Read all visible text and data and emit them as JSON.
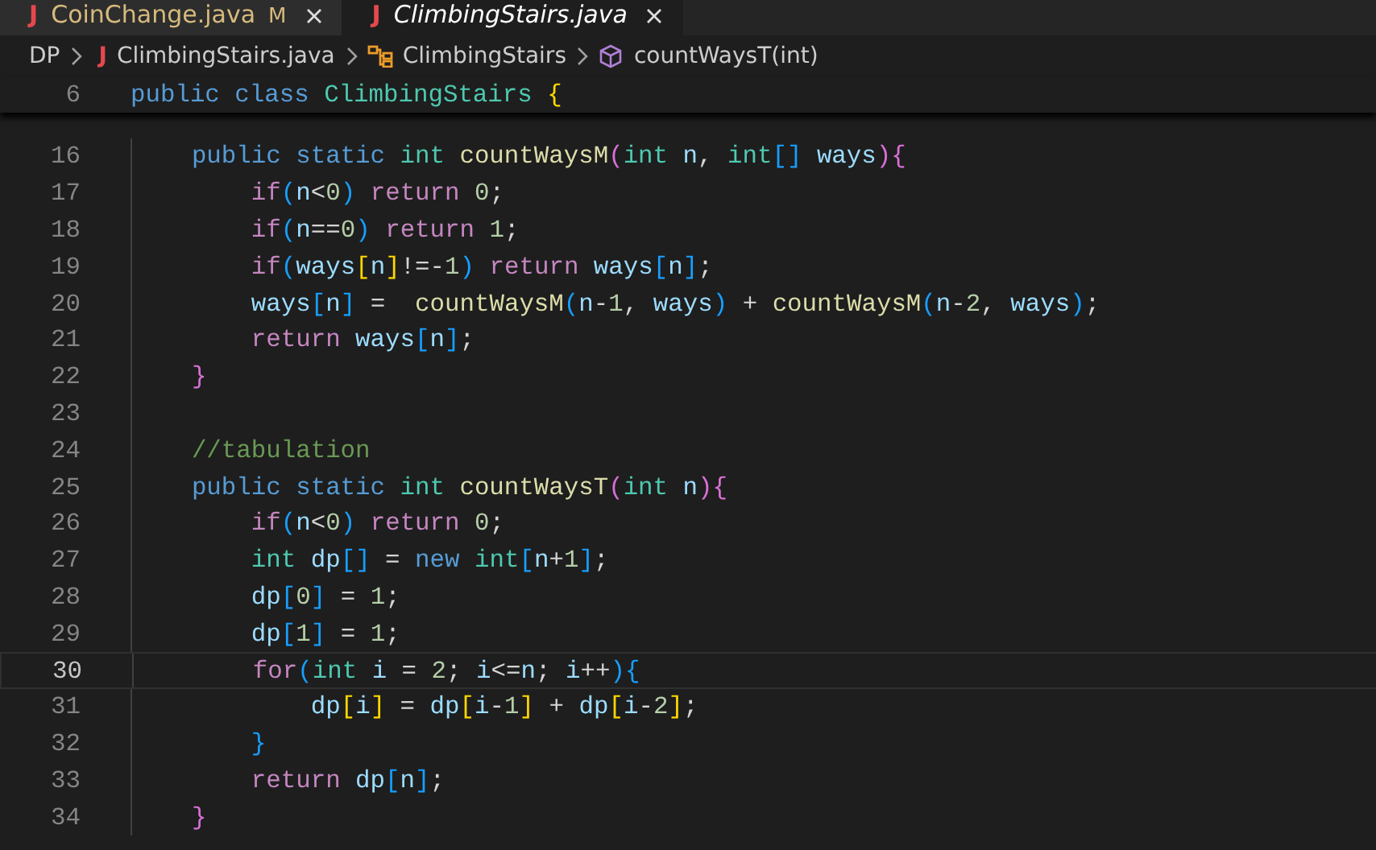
{
  "tabs": [
    {
      "icon": "J",
      "label": "CoinChange.java",
      "badge": "M",
      "selected": false
    },
    {
      "icon": "J",
      "label": "ClimbingStairs.java",
      "selected": true
    }
  ],
  "breadcrumb": [
    {
      "kind": "folder",
      "text": "DP"
    },
    {
      "kind": "file",
      "icon": "J",
      "text": "ClimbingStairs.java"
    },
    {
      "kind": "class",
      "text": "ClimbingStairs"
    },
    {
      "kind": "method",
      "text": "countWaysT(int)"
    }
  ],
  "sticky_line": {
    "number": "6",
    "tokens": [
      {
        "kind": "kw",
        "text": "public class "
      },
      {
        "kind": "type",
        "text": "ClimbingStairs "
      },
      {
        "kind": "br1",
        "text": "{"
      }
    ]
  },
  "lines": [
    {
      "number": "16",
      "current": false,
      "tokens": [
        {
          "kind": "kw",
          "text": "    public static "
        },
        {
          "kind": "type",
          "text": "int "
        },
        {
          "kind": "fn",
          "text": "countWaysM"
        },
        {
          "kind": "br2",
          "text": "("
        },
        {
          "kind": "type",
          "text": "int "
        },
        {
          "kind": "var",
          "text": "n"
        },
        {
          "kind": "op",
          "text": ", "
        },
        {
          "kind": "type",
          "text": "int"
        },
        {
          "kind": "br3",
          "text": "[] "
        },
        {
          "kind": "var",
          "text": "ways"
        },
        {
          "kind": "br2",
          "text": "){"
        }
      ]
    },
    {
      "number": "17",
      "current": false,
      "tokens": [
        {
          "kind": "ctl",
          "text": "        if"
        },
        {
          "kind": "br3",
          "text": "("
        },
        {
          "kind": "var",
          "text": "n"
        },
        {
          "kind": "op",
          "text": "<"
        },
        {
          "kind": "num",
          "text": "0"
        },
        {
          "kind": "br3",
          "text": ") "
        },
        {
          "kind": "ctl",
          "text": "return "
        },
        {
          "kind": "num",
          "text": "0"
        },
        {
          "kind": "op",
          "text": ";"
        }
      ]
    },
    {
      "number": "18",
      "current": false,
      "tokens": [
        {
          "kind": "ctl",
          "text": "        if"
        },
        {
          "kind": "br3",
          "text": "("
        },
        {
          "kind": "var",
          "text": "n"
        },
        {
          "kind": "op",
          "text": "=="
        },
        {
          "kind": "num",
          "text": "0"
        },
        {
          "kind": "br3",
          "text": ") "
        },
        {
          "kind": "ctl",
          "text": "return "
        },
        {
          "kind": "num",
          "text": "1"
        },
        {
          "kind": "op",
          "text": ";"
        }
      ]
    },
    {
      "number": "19",
      "current": false,
      "tokens": [
        {
          "kind": "ctl",
          "text": "        if"
        },
        {
          "kind": "br3",
          "text": "("
        },
        {
          "kind": "var",
          "text": "ways"
        },
        {
          "kind": "br1",
          "text": "["
        },
        {
          "kind": "var",
          "text": "n"
        },
        {
          "kind": "br1",
          "text": "]"
        },
        {
          "kind": "op",
          "text": "!=-"
        },
        {
          "kind": "num",
          "text": "1"
        },
        {
          "kind": "br3",
          "text": ") "
        },
        {
          "kind": "ctl",
          "text": "return "
        },
        {
          "kind": "var",
          "text": "ways"
        },
        {
          "kind": "br3",
          "text": "["
        },
        {
          "kind": "var",
          "text": "n"
        },
        {
          "kind": "br3",
          "text": "]"
        },
        {
          "kind": "op",
          "text": ";"
        }
      ]
    },
    {
      "number": "20",
      "current": false,
      "tokens": [
        {
          "kind": "var",
          "text": "        ways"
        },
        {
          "kind": "br3",
          "text": "["
        },
        {
          "kind": "var",
          "text": "n"
        },
        {
          "kind": "br3",
          "text": "]"
        },
        {
          "kind": "op",
          "text": " =  "
        },
        {
          "kind": "fn",
          "text": "countWaysM"
        },
        {
          "kind": "br3",
          "text": "("
        },
        {
          "kind": "var",
          "text": "n"
        },
        {
          "kind": "op",
          "text": "-"
        },
        {
          "kind": "num",
          "text": "1"
        },
        {
          "kind": "op",
          "text": ", "
        },
        {
          "kind": "var",
          "text": "ways"
        },
        {
          "kind": "br3",
          "text": ")"
        },
        {
          "kind": "op",
          "text": " + "
        },
        {
          "kind": "fn",
          "text": "countWaysM"
        },
        {
          "kind": "br3",
          "text": "("
        },
        {
          "kind": "var",
          "text": "n"
        },
        {
          "kind": "op",
          "text": "-"
        },
        {
          "kind": "num",
          "text": "2"
        },
        {
          "kind": "op",
          "text": ", "
        },
        {
          "kind": "var",
          "text": "ways"
        },
        {
          "kind": "br3",
          "text": ")"
        },
        {
          "kind": "op",
          "text": ";"
        }
      ]
    },
    {
      "number": "21",
      "current": false,
      "tokens": [
        {
          "kind": "ctl",
          "text": "        return "
        },
        {
          "kind": "var",
          "text": "ways"
        },
        {
          "kind": "br3",
          "text": "["
        },
        {
          "kind": "var",
          "text": "n"
        },
        {
          "kind": "br3",
          "text": "]"
        },
        {
          "kind": "op",
          "text": ";"
        }
      ]
    },
    {
      "number": "22",
      "current": false,
      "tokens": [
        {
          "kind": "br2",
          "text": "    }"
        }
      ]
    },
    {
      "number": "23",
      "current": false
    },
    {
      "number": "24",
      "current": false,
      "tokens": [
        {
          "kind": "cmt",
          "text": "    //tabulation"
        }
      ]
    },
    {
      "number": "25",
      "current": false,
      "tokens": [
        {
          "kind": "kw",
          "text": "    public static "
        },
        {
          "kind": "type",
          "text": "int "
        },
        {
          "kind": "fn",
          "text": "countWaysT"
        },
        {
          "kind": "br2",
          "text": "("
        },
        {
          "kind": "type",
          "text": "int "
        },
        {
          "kind": "var",
          "text": "n"
        },
        {
          "kind": "br2",
          "text": "){"
        }
      ]
    },
    {
      "number": "26",
      "current": false,
      "tokens": [
        {
          "kind": "ctl",
          "text": "        if"
        },
        {
          "kind": "br3",
          "text": "("
        },
        {
          "kind": "var",
          "text": "n"
        },
        {
          "kind": "op",
          "text": "<"
        },
        {
          "kind": "num",
          "text": "0"
        },
        {
          "kind": "br3",
          "text": ") "
        },
        {
          "kind": "ctl",
          "text": "return "
        },
        {
          "kind": "num",
          "text": "0"
        },
        {
          "kind": "op",
          "text": ";"
        }
      ]
    },
    {
      "number": "27",
      "current": false,
      "tokens": [
        {
          "kind": "type",
          "text": "        int "
        },
        {
          "kind": "var",
          "text": "dp"
        },
        {
          "kind": "br3",
          "text": "[]"
        },
        {
          "kind": "op",
          "text": " = "
        },
        {
          "kind": "kw",
          "text": "new "
        },
        {
          "kind": "type",
          "text": "int"
        },
        {
          "kind": "br3",
          "text": "["
        },
        {
          "kind": "var",
          "text": "n"
        },
        {
          "kind": "op",
          "text": "+"
        },
        {
          "kind": "num",
          "text": "1"
        },
        {
          "kind": "br3",
          "text": "]"
        },
        {
          "kind": "op",
          "text": ";"
        }
      ]
    },
    {
      "number": "28",
      "current": false,
      "tokens": [
        {
          "kind": "var",
          "text": "        dp"
        },
        {
          "kind": "br3",
          "text": "["
        },
        {
          "kind": "num",
          "text": "0"
        },
        {
          "kind": "br3",
          "text": "]"
        },
        {
          "kind": "op",
          "text": " = "
        },
        {
          "kind": "num",
          "text": "1"
        },
        {
          "kind": "op",
          "text": ";"
        }
      ]
    },
    {
      "number": "29",
      "current": false,
      "tokens": [
        {
          "kind": "var",
          "text": "        dp"
        },
        {
          "kind": "br3",
          "text": "["
        },
        {
          "kind": "num",
          "text": "1"
        },
        {
          "kind": "br3",
          "text": "]"
        },
        {
          "kind": "op",
          "text": " = "
        },
        {
          "kind": "num",
          "text": "1"
        },
        {
          "kind": "op",
          "text": ";"
        }
      ]
    },
    {
      "number": "30",
      "current": true,
      "tokens": [
        {
          "kind": "ctl",
          "text": "        for"
        },
        {
          "kind": "br3",
          "text": "("
        },
        {
          "kind": "type",
          "text": "int "
        },
        {
          "kind": "var",
          "text": "i"
        },
        {
          "kind": "op",
          "text": " = "
        },
        {
          "kind": "num",
          "text": "2"
        },
        {
          "kind": "op",
          "text": "; "
        },
        {
          "kind": "var",
          "text": "i"
        },
        {
          "kind": "op",
          "text": "<="
        },
        {
          "kind": "var",
          "text": "n"
        },
        {
          "kind": "op",
          "text": "; "
        },
        {
          "kind": "var",
          "text": "i"
        },
        {
          "kind": "op",
          "text": "++"
        },
        {
          "kind": "br3",
          "text": "){"
        }
      ]
    },
    {
      "number": "31",
      "current": false,
      "tokens": [
        {
          "kind": "var",
          "text": "            dp"
        },
        {
          "kind": "br1",
          "text": "["
        },
        {
          "kind": "var",
          "text": "i"
        },
        {
          "kind": "br1",
          "text": "]"
        },
        {
          "kind": "op",
          "text": " = "
        },
        {
          "kind": "var",
          "text": "dp"
        },
        {
          "kind": "br1",
          "text": "["
        },
        {
          "kind": "var",
          "text": "i"
        },
        {
          "kind": "op",
          "text": "-"
        },
        {
          "kind": "num",
          "text": "1"
        },
        {
          "kind": "br1",
          "text": "]"
        },
        {
          "kind": "op",
          "text": " + "
        },
        {
          "kind": "var",
          "text": "dp"
        },
        {
          "kind": "br1",
          "text": "["
        },
        {
          "kind": "var",
          "text": "i"
        },
        {
          "kind": "op",
          "text": "-"
        },
        {
          "kind": "num",
          "text": "2"
        },
        {
          "kind": "br1",
          "text": "]"
        },
        {
          "kind": "op",
          "text": ";"
        }
      ]
    },
    {
      "number": "32",
      "current": false,
      "tokens": [
        {
          "kind": "br3",
          "text": "        }"
        }
      ]
    },
    {
      "number": "33",
      "current": false,
      "tokens": [
        {
          "kind": "ctl",
          "text": "        return "
        },
        {
          "kind": "var",
          "text": "dp"
        },
        {
          "kind": "br3",
          "text": "["
        },
        {
          "kind": "var",
          "text": "n"
        },
        {
          "kind": "br3",
          "text": "]"
        },
        {
          "kind": "op",
          "text": ";"
        }
      ]
    },
    {
      "number": "34",
      "current": false,
      "tokens": [
        {
          "kind": "br2",
          "text": "    }"
        }
      ]
    }
  ]
}
